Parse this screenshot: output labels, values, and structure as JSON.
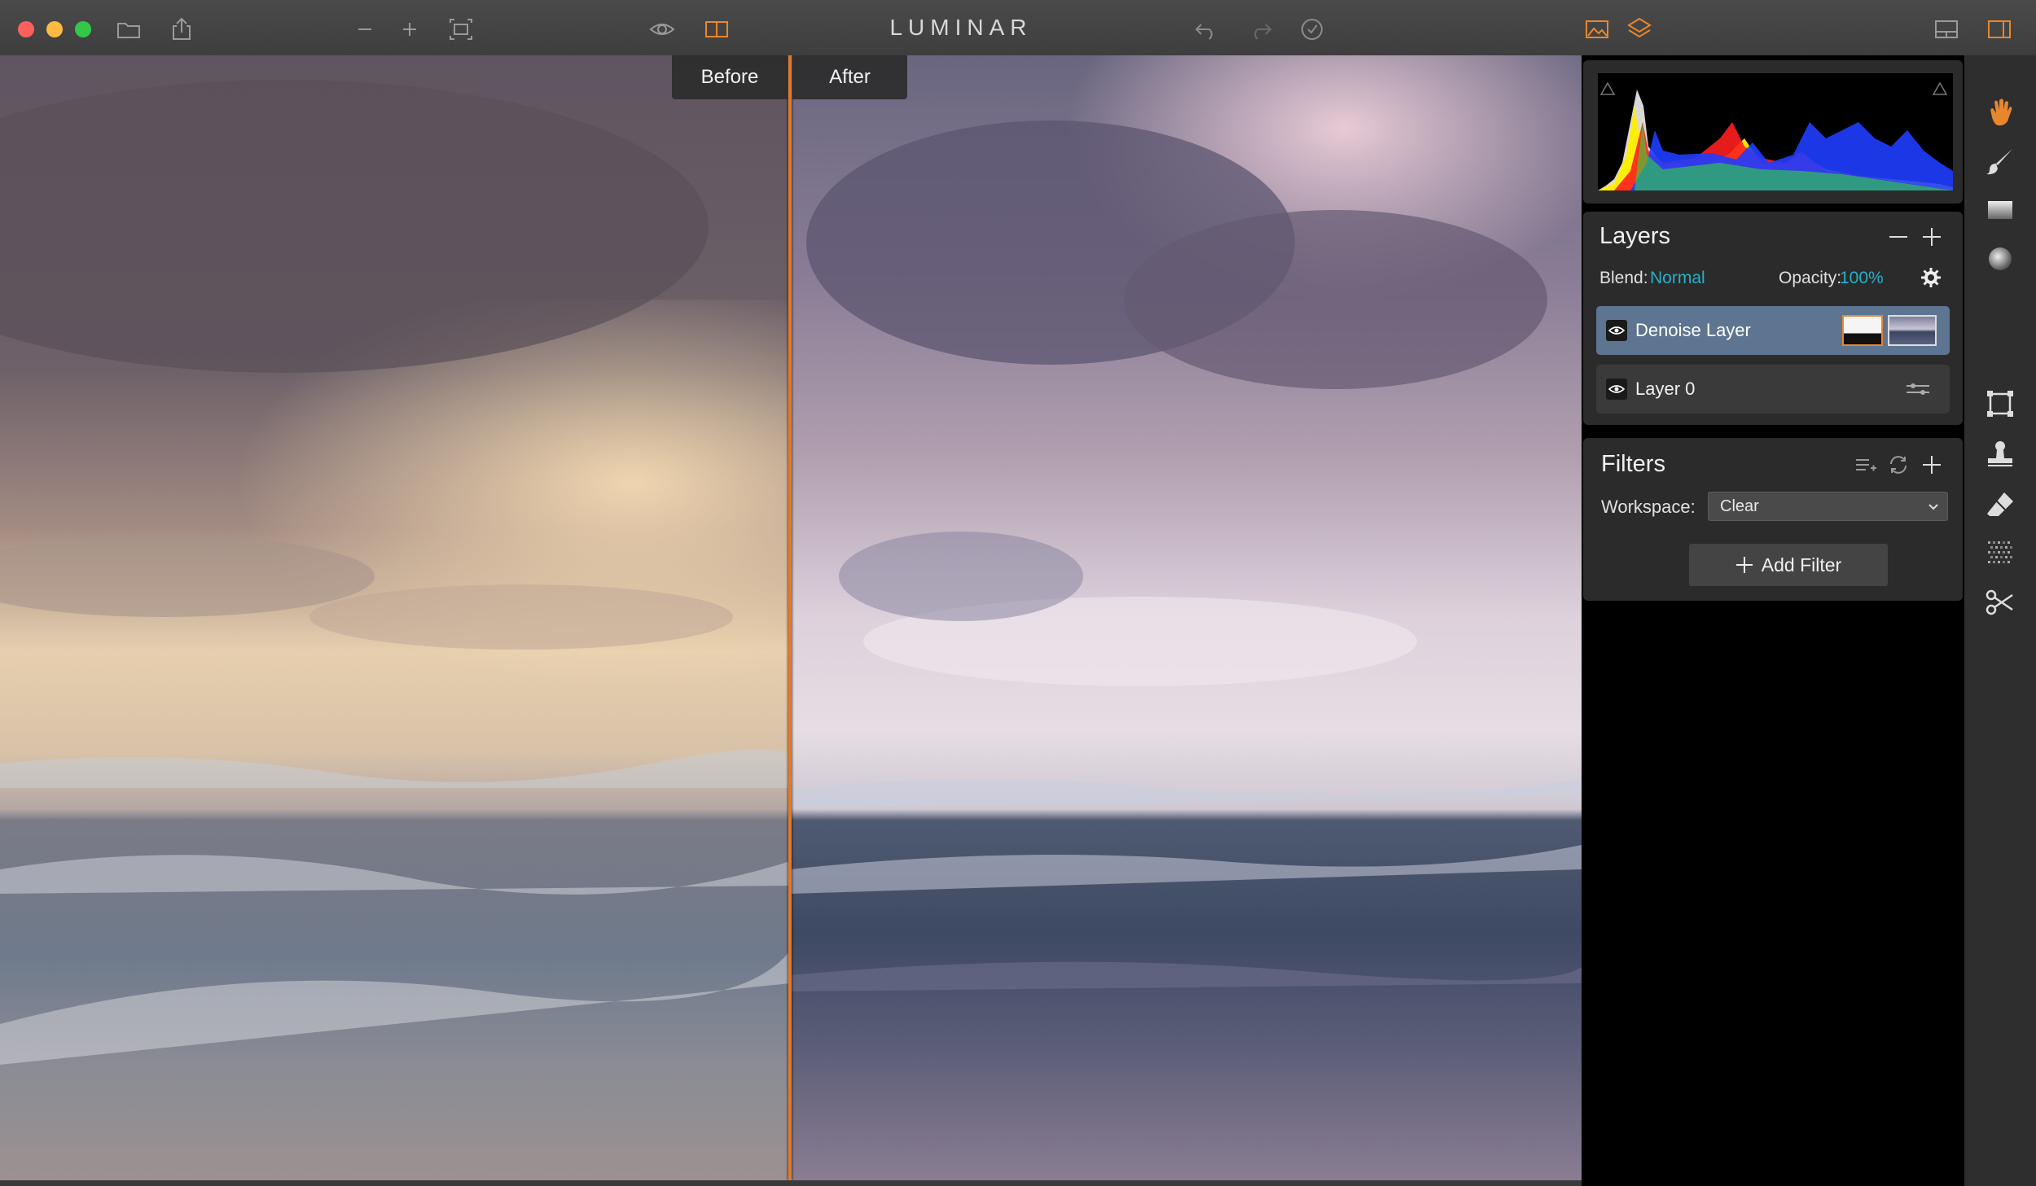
{
  "app": {
    "title": "LUMINAR"
  },
  "window_controls": {
    "close": "#fc605c",
    "minimize": "#fcbb40",
    "maximize": "#34c84a"
  },
  "toolbar": {
    "left_icons": [
      "folder-icon",
      "share-icon",
      "zoom-out-icon",
      "zoom-in-icon",
      "fit-screen-icon"
    ],
    "view_icons": [
      "eye-icon",
      "split-view-icon"
    ],
    "history_icons": [
      "undo-icon",
      "redo-icon",
      "history-icon"
    ],
    "panel_icons": [
      "image-icon",
      "layers-icon"
    ],
    "right_icons": [
      "layout-icon",
      "sidebar-toggle-icon"
    ]
  },
  "compare": {
    "before_label": "Before",
    "after_label": "After",
    "split_color": "#e07a2c"
  },
  "histogram": {
    "channels": [
      "red",
      "yellow",
      "green",
      "blue",
      "white"
    ]
  },
  "layers": {
    "title": "Layers",
    "blend_label": "Blend:",
    "blend_value": "Normal",
    "opacity_label": "Opacity:",
    "opacity_value": "100%",
    "items": [
      {
        "name": "Denoise Layer",
        "selected": true
      },
      {
        "name": "Layer 0",
        "selected": false
      }
    ]
  },
  "filters": {
    "title": "Filters",
    "workspace_label": "Workspace:",
    "workspace_value": "Clear",
    "add_filter_label": "Add Filter"
  },
  "tools": [
    "hand-icon",
    "brush-icon",
    "gradient-icon",
    "radial-icon",
    "crop-icon",
    "stamp-icon",
    "eraser-icon",
    "noise-icon",
    "cut-icon"
  ],
  "colors": {
    "accent": "#27b0c9",
    "selected_layer": "#5d7590",
    "active_tool": "#e8862e"
  }
}
